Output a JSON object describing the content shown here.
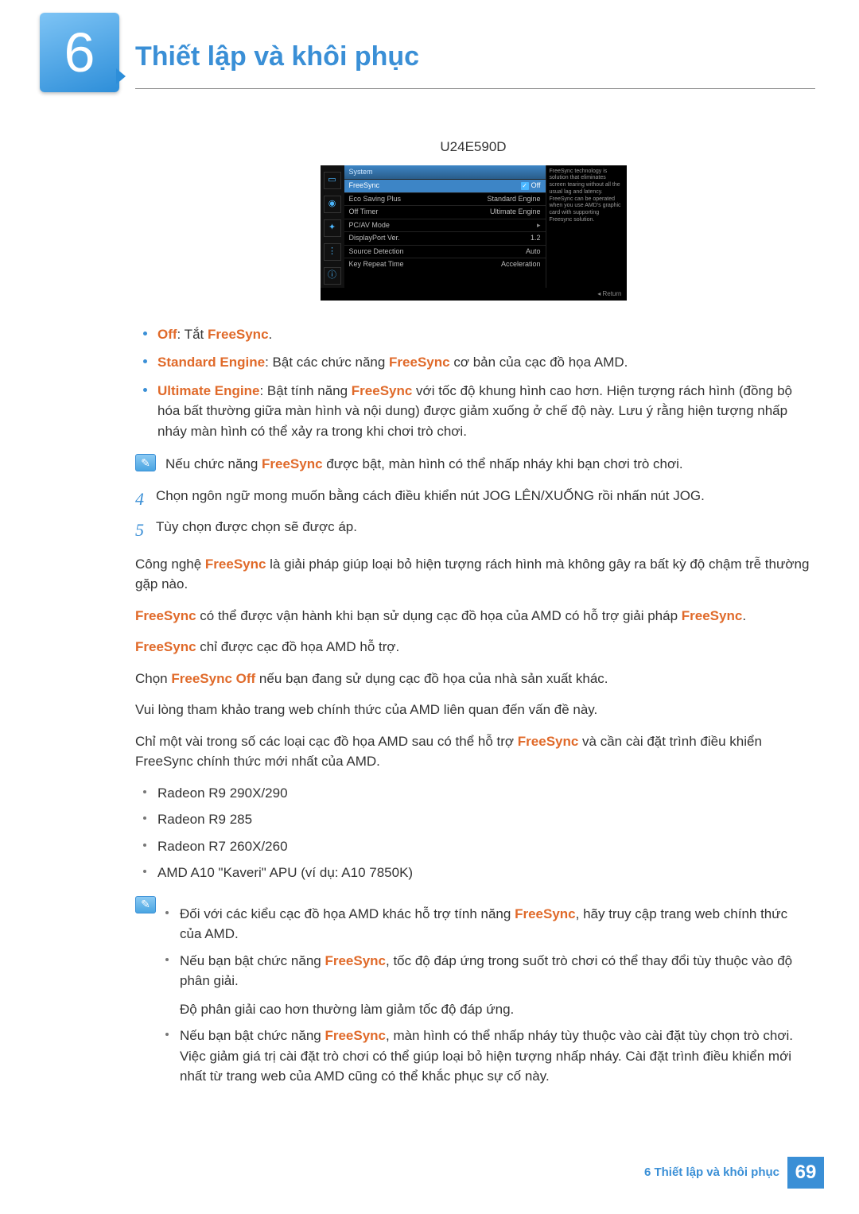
{
  "chapter": {
    "number": "6",
    "title": "Thiết lập và khôi phục"
  },
  "model": "U24E590D",
  "osd": {
    "category": "System",
    "icons": [
      "▭",
      "◉",
      "✦",
      "⋮",
      "ⓘ"
    ],
    "rows": [
      {
        "label": "FreeSync",
        "value": "Off",
        "highlighted": true,
        "checked": true
      },
      {
        "label": "Eco Saving Plus",
        "value": "Standard Engine"
      },
      {
        "label": "Off Timer",
        "value": "Ultimate Engine"
      },
      {
        "label": "PC/AV Mode",
        "value": "▸"
      },
      {
        "label": "DisplayPort Ver.",
        "value": "1.2"
      },
      {
        "label": "Source Detection",
        "value": "Auto"
      },
      {
        "label": "Key Repeat Time",
        "value": "Acceleration"
      }
    ],
    "info": "FreeSync technology is solution that eliminates screen tearing without all the usual lag and latency. FreeSync can be operated when you use AMD's graphic card with supporting Freesync solution.",
    "return": "Return"
  },
  "options": {
    "off_key": "Off",
    "off_text": ": Tắt ",
    "off_fs": "FreeSync",
    "off_end": ".",
    "std_key": "Standard Engine",
    "std_text": ": Bật các chức năng ",
    "std_fs": "FreeSync",
    "std_end": " cơ bản của cạc đồ họa AMD.",
    "ult_key": "Ultimate Engine",
    "ult_text": ": Bật tính năng ",
    "ult_fs": "FreeSync",
    "ult_rest": " với tốc độ khung hình cao hơn. Hiện tượng rách hình (đồng bộ hóa bất thường giữa màn hình và nội dung) được giảm xuống ở chế độ này. Lưu ý rằng hiện tượng nhấp nháy màn hình có thể xảy ra trong khi chơi trò chơi."
  },
  "note1_a": "Nếu chức năng ",
  "note1_b": "FreeSync",
  "note1_c": " được bật, màn hình có thể nhấp nháy khi bạn chơi trò chơi.",
  "steps": {
    "s4": {
      "num": "4",
      "text": "Chọn ngôn ngữ mong muốn bằng cách điều khiển nút JOG LÊN/XUỐNG rồi nhấn nút JOG."
    },
    "s5": {
      "num": "5",
      "text": "Tùy chọn được chọn sẽ được áp."
    }
  },
  "p1_a": "Công nghệ ",
  "p1_b": "FreeSync",
  "p1_c": " là giải pháp giúp loại bỏ hiện tượng rách hình mà không gây ra bất kỳ độ chậm trễ thường gặp nào.",
  "p2_a": "FreeSync",
  "p2_b": " có thể được vận hành khi bạn sử dụng cạc đồ họa của AMD có hỗ trợ giải pháp ",
  "p2_c": "FreeSync",
  "p2_d": ".",
  "p3_a": "FreeSync",
  "p3_b": " chỉ được cạc đồ họa AMD hỗ trợ.",
  "p4_a": "Chọn ",
  "p4_b": "FreeSync Off",
  "p4_c": " nếu bạn đang sử dụng cạc đồ họa của nhà sản xuất khác.",
  "p5": "Vui lòng tham khảo trang web chính thức của AMD liên quan đến vấn đề này.",
  "p6_a": "Chỉ một vài trong số các loại cạc đồ họa AMD sau có thể hỗ trợ ",
  "p6_b": "FreeSync",
  "p6_c": " và cần cài đặt trình điều khiển FreeSync chính thức mới nhất của AMD.",
  "gpus": [
    "Radeon R9 290X/290",
    "Radeon R9 285",
    "Radeon R7 260X/260",
    "AMD A10 \"Kaveri\" APU (ví dụ: A10 7850K)"
  ],
  "note2": {
    "n1_a": "Đối với các kiểu cạc đồ họa AMD khác hỗ trợ tính năng ",
    "n1_b": "FreeSync",
    "n1_c": ", hãy truy cập trang web chính thức của AMD.",
    "n2_a": "Nếu bạn bật chức năng ",
    "n2_b": "FreeSync",
    "n2_c": ", tốc độ đáp ứng trong suốt trò chơi có thể thay đổi tùy thuộc vào độ phân giải.",
    "n2_d": "Độ phân giải cao hơn thường làm giảm tốc độ đáp ứng.",
    "n3_a": "Nếu bạn bật chức năng ",
    "n3_b": "FreeSync",
    "n3_c": ", màn hình có thể nhấp nháy tùy thuộc vào cài đặt tùy chọn trò chơi. Việc giảm giá trị cài đặt trò chơi có thể giúp loại bỏ hiện tượng nhấp nháy. Cài đặt trình điều khiển mới nhất từ trang web của AMD cũng có thể khắc phục sự cố này."
  },
  "footer": {
    "text": "6 Thiết lập và khôi phục",
    "page": "69"
  }
}
